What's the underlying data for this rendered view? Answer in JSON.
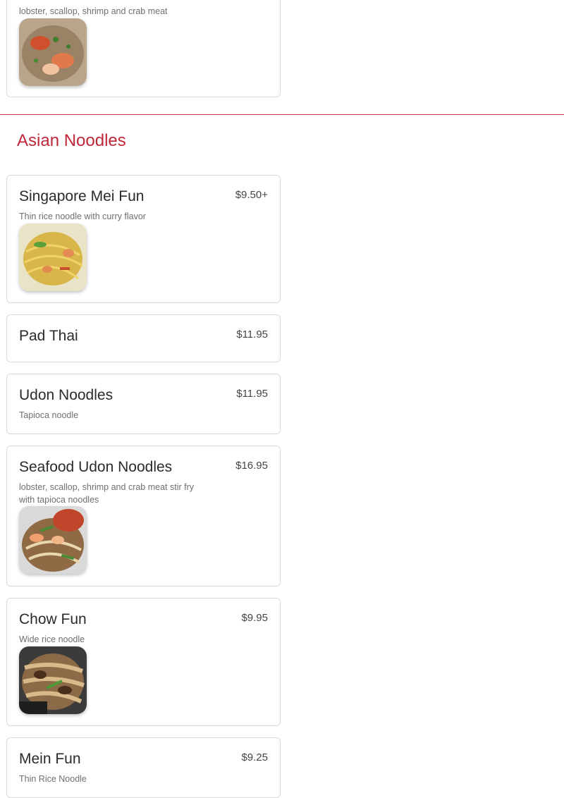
{
  "colors": {
    "accent": "#c0283a",
    "divider": "#c9374a",
    "card_border": "#dadada"
  },
  "top_card": {
    "desc": "lobster, scallop, shrimp and crab meat",
    "image_icon": "seafood-dish-photo"
  },
  "section": {
    "title": "Asian Noodles"
  },
  "items": [
    {
      "name": "Singapore Mei Fun",
      "price": "$9.50+",
      "desc": "Thin rice noodle with curry flavor",
      "image_icon": "mei-fun-photo"
    },
    {
      "name": "Pad Thai",
      "price": "$11.95",
      "desc": ""
    },
    {
      "name": "Udon Noodles",
      "price": "$11.95",
      "desc": "Tapioca noodle"
    },
    {
      "name": "Seafood Udon Noodles",
      "price": "$16.95",
      "desc": "lobster, scallop, shrimp and crab meat stir fry with tapioca noodles",
      "image_icon": "seafood-udon-photo"
    },
    {
      "name": "Chow Fun",
      "price": "$9.95",
      "desc": "Wide rice noodle",
      "image_icon": "chow-fun-photo"
    },
    {
      "name": "Mein Fun",
      "price": "$9.25",
      "desc": "Thin Rice Noodle"
    }
  ]
}
